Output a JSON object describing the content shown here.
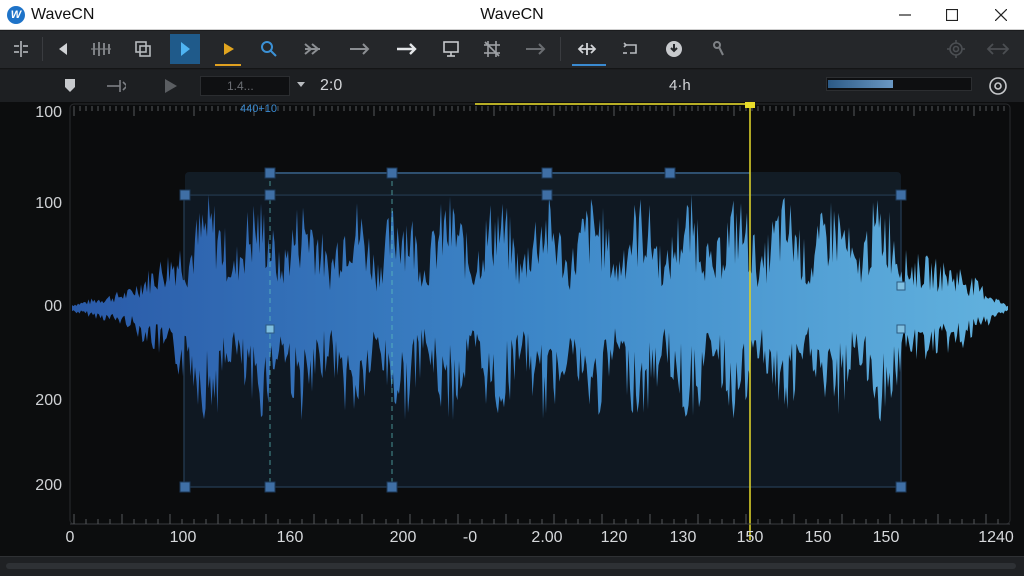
{
  "app": {
    "name": "WaveCN",
    "window_title": "WaveCN"
  },
  "window_controls": {
    "minimize": "minimize",
    "maximize": "maximize",
    "close": "close"
  },
  "toolbar": {
    "buttons": [
      {
        "icon": "snap-icon"
      },
      {
        "icon": "back-arrow-icon"
      },
      {
        "icon": "bars-icon"
      },
      {
        "icon": "copy-icon"
      },
      {
        "icon": "select-tool-icon"
      },
      {
        "icon": "play-tool-icon"
      },
      {
        "icon": "zoom-icon"
      },
      {
        "icon": "fast-forward-icon"
      },
      {
        "icon": "arrow-right-icon"
      },
      {
        "icon": "arrow-right-bold-icon"
      },
      {
        "icon": "monitor-icon"
      },
      {
        "icon": "grid-icon"
      },
      {
        "icon": "arrow-right-dim-icon"
      },
      {
        "icon": "split-icon"
      },
      {
        "icon": "loop-icon"
      },
      {
        "icon": "record-icon"
      },
      {
        "icon": "tool-icon"
      },
      {
        "icon": "gear-icon"
      },
      {
        "icon": "expand-icon"
      }
    ]
  },
  "transport": {
    "position_value": "1.4...",
    "zoom_value": "2:0",
    "playhead_readout": "4·h",
    "level_fraction": 0.45
  },
  "ruler": {
    "label": "440+10"
  },
  "y_axis": {
    "labels": [
      "100",
      "100",
      "00",
      "200",
      "200"
    ]
  },
  "x_axis": {
    "labels": [
      "0",
      "100",
      "160",
      "200",
      "-0",
      "2.00",
      "120",
      "130",
      "150",
      "150",
      "150",
      "1240"
    ]
  },
  "colors": {
    "waveform_start": "#2d62b3",
    "waveform_end": "#5aa6d8",
    "playhead": "#d9cf2a",
    "selection": "#3d6fa3"
  }
}
